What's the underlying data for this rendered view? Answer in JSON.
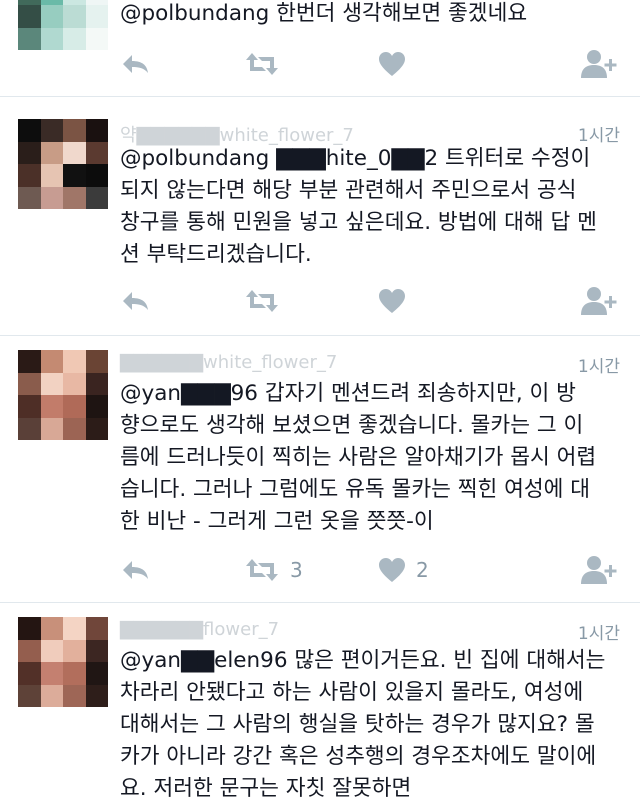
{
  "tweets": [
    {
      "user": "",
      "time": "",
      "text": "@polbundang 한번더 생각해보면 좋겠네요",
      "retweets": "",
      "likes": ""
    },
    {
      "user": "약▇▇▇▇▇▇white_flower_7",
      "time": "1시간",
      "text": "@polbundang ▇▇▇hite_0▇▇2 트위터로 수정이\n되지 않는다면 해당 부분 관련해서 주민으로서 공식\n창구를 통해 민원을 넣고 싶은데요. 방법에 대해 답 멘\n션 부탁드리겠습니다.",
      "retweets": "",
      "likes": ""
    },
    {
      "user": "▇▇▇▇▇▇white_flower_7",
      "time": "1시간",
      "text": "@yan▇▇▇96 갑자기 멘션드려 죄송하지만, 이 방\n향으로도 생각해 보셨으면 좋겠습니다. 몰카는 그 이\n름에 드러나듯이 찍히는 사람은 알아채기가 몹시 어렵\n습니다. 그러나 그럼에도 유독 몰카는 찍힌 여성에 대\n한 비난 - 그러게 그런 옷을 쯧쯧-이",
      "retweets": "3",
      "likes": "2"
    },
    {
      "user": "▇▇▇▇▇▇flower_7",
      "time": "1시간",
      "text": "@yan▇▇elen96 많은 편이거든요. 빈 집에 대해서는\n차라리 안됐다고 하는 사람이 있을지 몰라도, 여성에\n대해서는 그 사람의 행실을 탓하는 경우가 많지요? 몰\n카가 아니라 강간 혹은 성추행의 경우조차에도 말이에\n요. 저러한 문구는 자칫 잘못하면",
      "retweets": "",
      "likes": ""
    }
  ],
  "colors": {
    "icon": "#aab8c2",
    "text": "#141823",
    "secondary": "#8899a6",
    "divider": "#e1e8ed"
  }
}
